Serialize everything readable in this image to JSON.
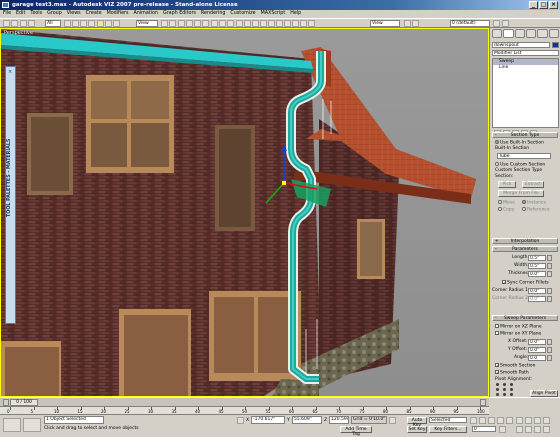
{
  "window": {
    "title": "garage test3.max - Autodesk VIZ 2007 pre-release - Stand-alone License"
  },
  "menu": [
    "File",
    "Edit",
    "Tools",
    "Group",
    "Views",
    "Create",
    "Modifiers",
    "Animation",
    "Graph Editors",
    "Rendering",
    "Customize",
    "MAXScript",
    "Help"
  ],
  "toolbar": {
    "selection_filter": "All",
    "ref_coord": "View",
    "ref_coord2": "View",
    "named_set": "0 (default)"
  },
  "viewport": {
    "label": "Perspective"
  },
  "sidebar": {
    "label": "TOOL PALETTES - MATERIALS"
  },
  "panel": {
    "object_name": "downspout",
    "modifier_list": "Modifier List",
    "stack": [
      "Sweep",
      "Line"
    ],
    "section_type": {
      "header": "Section Type",
      "use_builtin": "Use Built-In Section",
      "builtin_label": "Built-In Section",
      "builtin_value": "Tube",
      "use_custom": "Use Custom Section",
      "custom_types": "Custom Section Type",
      "section": "Section:",
      "pick": "Pick",
      "extract": "Extract",
      "merge_from_file": "Merge From File",
      "move": "Move",
      "instance": "Instance",
      "copy": "Copy",
      "reference": "Reference"
    },
    "interpolation": {
      "header": "Interpolation"
    },
    "parameters": {
      "header": "Parameters",
      "length_label": "Length:",
      "length": "0.5\"",
      "width_label": "Width:",
      "width": "0.5\"",
      "thickness_label": "Thickness:",
      "thickness": "0.0\"",
      "sync_corners": "Sync Corner Fillets",
      "corner_r1_label": "Corner Radius 1:",
      "corner_r1": "0.0\"",
      "corner_r2_label": "Corner Radius 2:",
      "corner_r2": "0.0\""
    },
    "sweep_parameters": {
      "header": "Sweep Parameters",
      "mirror_xz": "Mirror on XZ Plane",
      "mirror_xy": "Mirror on XY Plane",
      "x_offset_label": "X Offset:",
      "x_offset": "0.0\"",
      "y_offset_label": "Y Offset:",
      "y_offset": "0.0\"",
      "angle_label": "Angle:",
      "angle": "0.0",
      "smooth_section": "Smooth Section",
      "smooth_path": "Smooth Path",
      "pivot_alignment": "Pivot Alignment:",
      "align_pivot": "Align Pivot"
    }
  },
  "timeline": {
    "frame": "0 / 100",
    "ticks": [
      "0",
      "5",
      "10",
      "15",
      "20",
      "25",
      "30",
      "35",
      "40",
      "45",
      "50",
      "55",
      "60",
      "65",
      "70",
      "75",
      "80",
      "85",
      "90",
      "95",
      "100"
    ]
  },
  "status": {
    "selected": "1 Object Selected",
    "prompt": "Click and drag to select and move objects",
    "x_label": "X",
    "x": "-170.617\"",
    "y_label": "Y",
    "y": "55.609\"",
    "z_label": "Z",
    "z": "120.594\"",
    "grid": "Grid = 0'10.0\"",
    "add_time_tag": "Add Time Tag",
    "auto_key": "Auto Key",
    "set_key": "Set Key",
    "selected_mode": "Selected",
    "key_filters": "Key Filters...",
    "frame_field": "0"
  },
  "colors": {
    "accent": "#0a246a",
    "downspout": "#1fb0a8",
    "gutter": "#38d0d0",
    "brick": "#6a3c38",
    "roof": "#b24a2c"
  }
}
